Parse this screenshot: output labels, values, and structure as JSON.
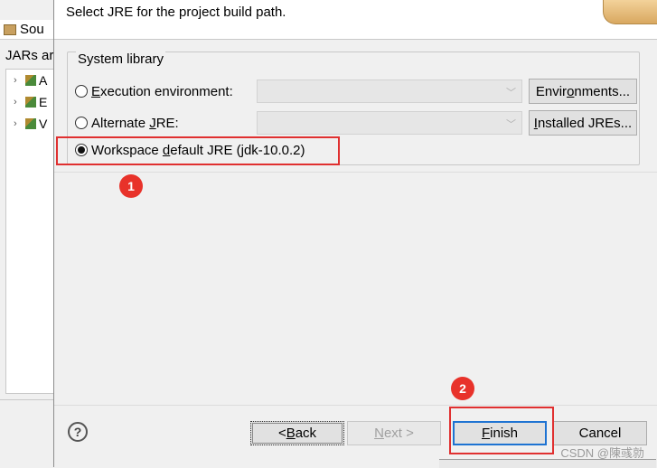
{
  "background_window": {
    "tab_label": "Sou",
    "heading": "JARs ar",
    "tree_items": [
      {
        "label": "A"
      },
      {
        "label": "E"
      },
      {
        "label": "V"
      }
    ]
  },
  "dialog": {
    "header_message": "Select JRE for the project build path.",
    "group_title": "System library",
    "options": {
      "execution_env": {
        "pre": "",
        "mnemonic": "E",
        "post": "xecution environment:",
        "button_pre": "Envir",
        "button_mnemonic": "o",
        "button_post": "nments..."
      },
      "alternate_jre": {
        "pre": "Alternate ",
        "mnemonic": "J",
        "post": "RE:",
        "button_pre": "",
        "button_mnemonic": "I",
        "button_post": "nstalled JREs..."
      },
      "workspace_default": {
        "pre": "Workspace ",
        "mnemonic": "d",
        "post": "efault JRE (jdk-10.0.2)",
        "selected": true
      }
    },
    "buttons": {
      "back": {
        "pre": "< ",
        "mnemonic": "B",
        "post": "ack"
      },
      "next": {
        "pre": "",
        "mnemonic": "N",
        "post": "ext >"
      },
      "finish": {
        "pre": "",
        "mnemonic": "F",
        "post": "inish"
      },
      "cancel": "Cancel"
    },
    "help_icon_glyph": "?"
  },
  "annotations": {
    "badge_1": "1",
    "badge_2": "2",
    "color": "#e03030"
  },
  "watermark": "CSDN @陳彧勍"
}
